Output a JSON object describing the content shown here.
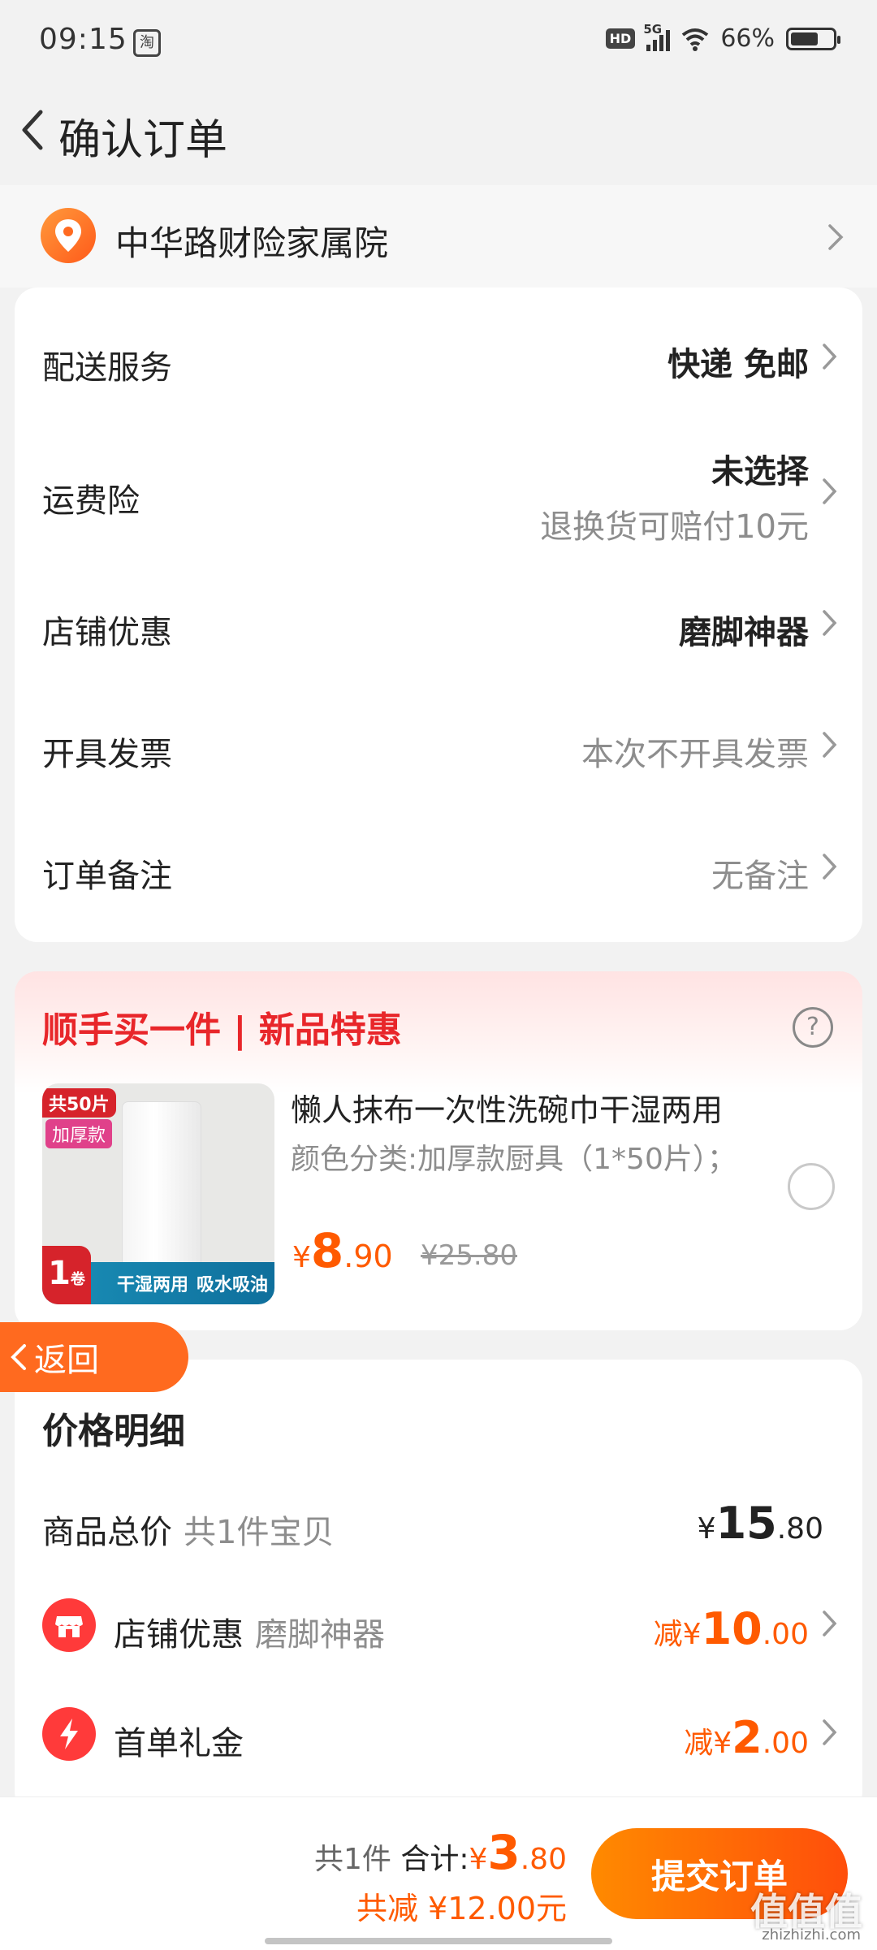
{
  "status_bar": {
    "time": "09:15",
    "app_icon": "淘",
    "hd": "HD",
    "network": "5G",
    "battery_percent": "66%",
    "battery_level": 0.66
  },
  "header": {
    "title": "确认订单"
  },
  "address": {
    "text": "中华路财险家属院"
  },
  "order_options": {
    "delivery_label": "配送服务",
    "delivery_value": "快递 免邮",
    "insurance_label": "运费险",
    "insurance_value": "未选择",
    "insurance_note": "退换货可赔付10元",
    "shop_discount_label": "店铺优惠",
    "shop_discount_value": "磨脚神器",
    "invoice_label": "开具发票",
    "invoice_value": "本次不开具发票",
    "remark_label": "订单备注",
    "remark_value": "无备注"
  },
  "promo": {
    "title": "顺手买一件 | 新品特惠",
    "help_icon": "?",
    "tag_count": "共50片",
    "tag_thick": "加厚款",
    "tag_roll_num": "1",
    "tag_roll_unit": "卷",
    "tag_feature_1": "干湿两用",
    "tag_feature_2": "吸水吸油",
    "product_name": "懒人抹布一次性洗碗巾干湿两用",
    "product_spec": "颜色分类:加厚款厨具（1*50片）；",
    "price_symbol": "¥",
    "price_int": "8",
    "price_dec": ".90",
    "price_old": "¥25.80"
  },
  "return_button": {
    "label": "返回"
  },
  "price_detail": {
    "title": "价格明细",
    "goods_total_label": "商品总价",
    "goods_total_sub": "共1件宝贝",
    "goods_total_symbol": "¥",
    "goods_total_int": "15",
    "goods_total_dec": ".80",
    "shop_discount_label": "店铺优惠",
    "shop_discount_sub": "磨脚神器",
    "shop_discount_prefix": "减",
    "shop_discount_symbol": "¥",
    "shop_discount_int": "10",
    "shop_discount_dec": ".00",
    "first_order_label": "首单礼金",
    "first_order_prefix": "减",
    "first_order_symbol": "¥",
    "first_order_int": "2",
    "first_order_dec": ".00"
  },
  "bottom_bar": {
    "count": "共1件",
    "total_label": "合计:",
    "total_symbol": "¥",
    "total_int": "3",
    "total_dec": ".80",
    "saving": "共减 ¥12.00元",
    "submit_label": "提交订单"
  },
  "watermark": {
    "text": "值值值",
    "url": "zhizhizhi.com"
  },
  "colors": {
    "accent": "#ff5a00",
    "promo_red": "#e8262a",
    "background": "#f2f2f2"
  }
}
